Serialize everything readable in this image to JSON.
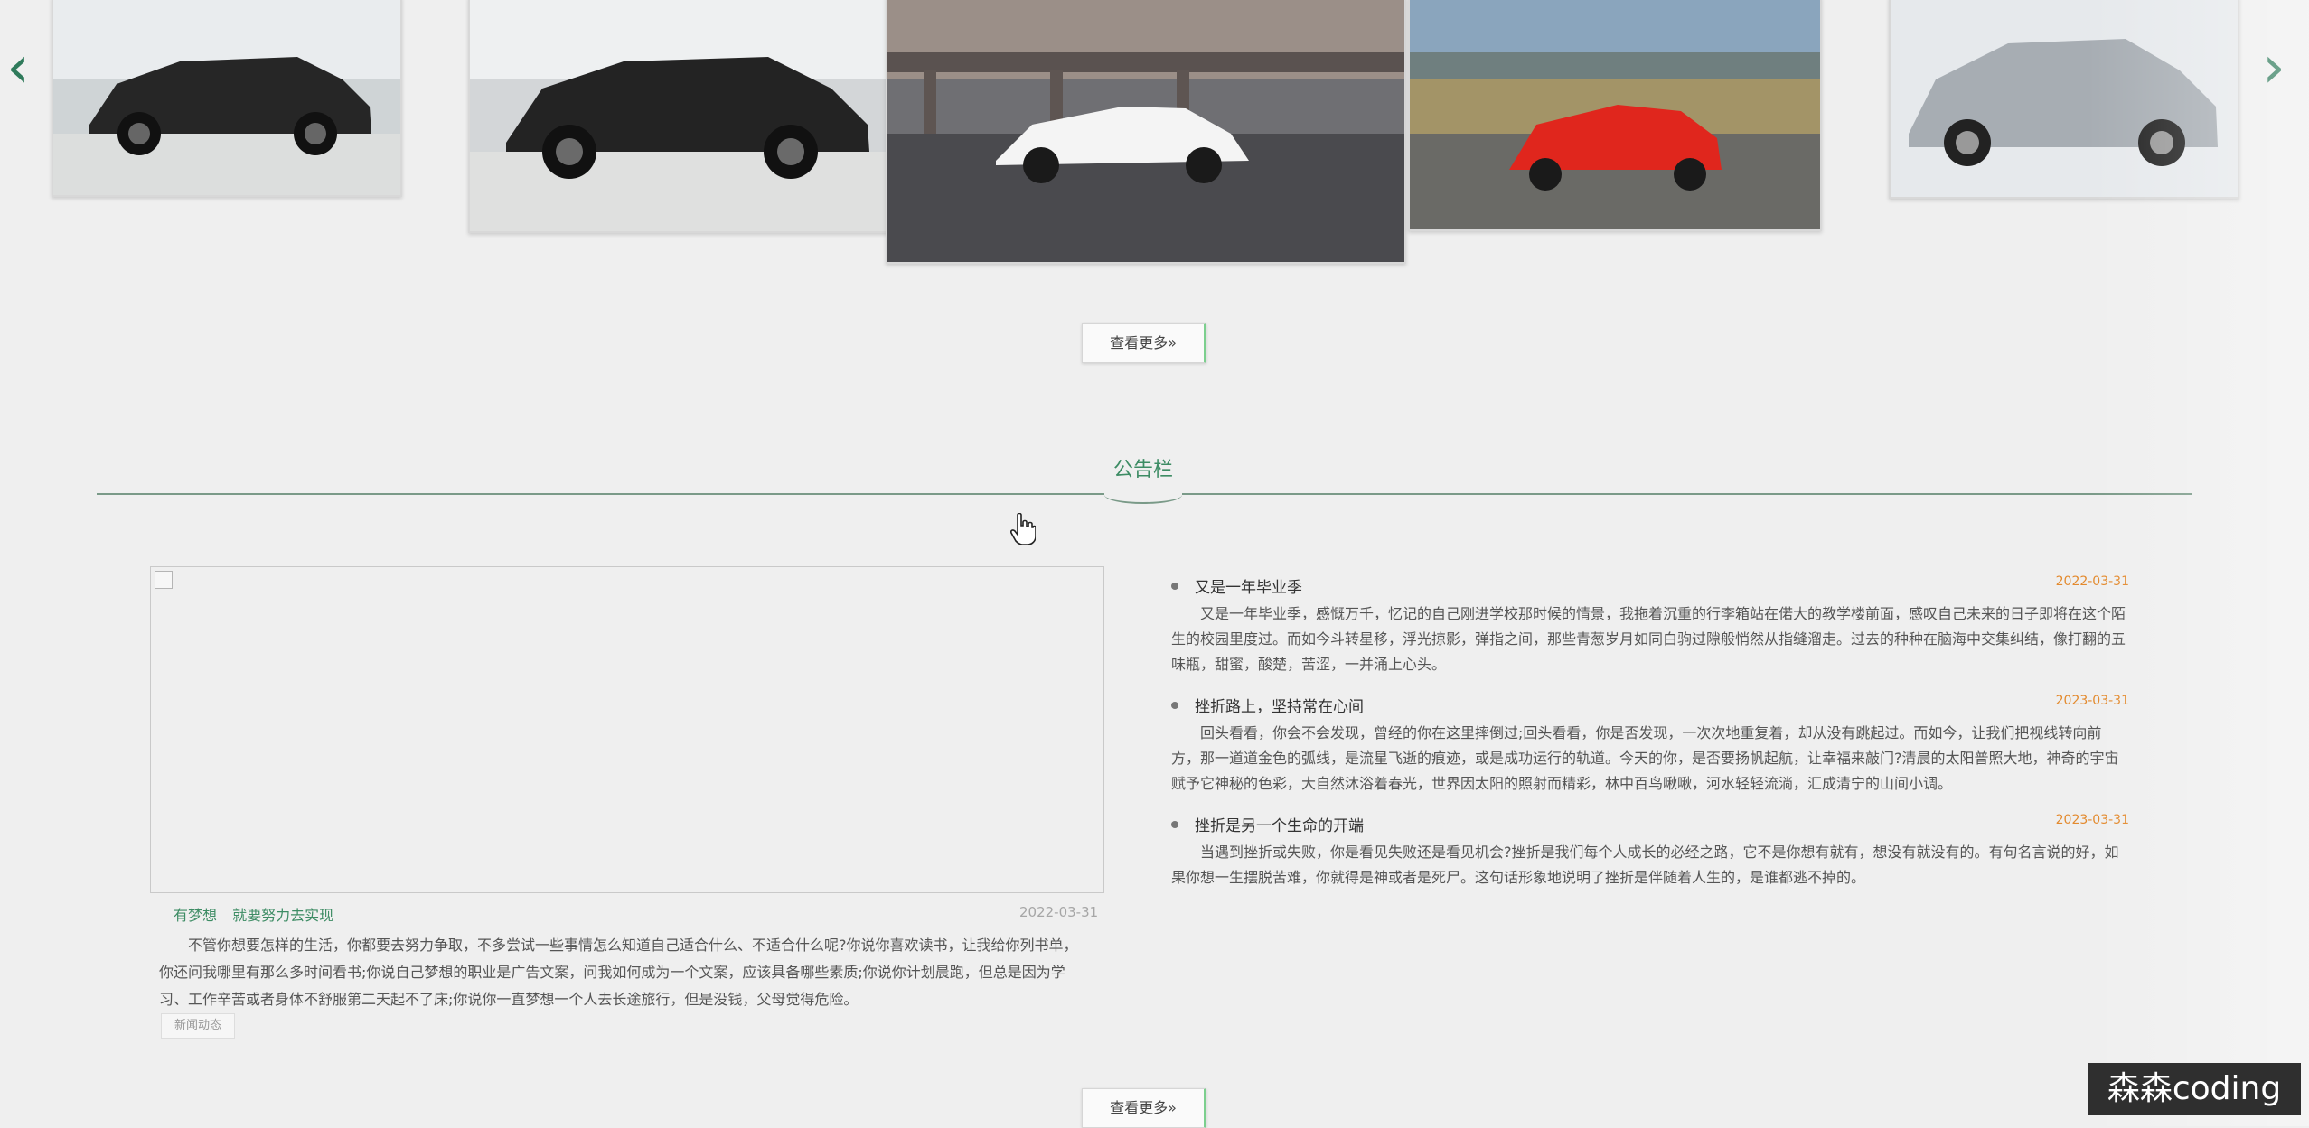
{
  "carousel": {
    "prev_label": "‹",
    "next_label": "›",
    "slides": [
      {
        "alt": "black SUV in showroom",
        "accent": "#1f1f1f"
      },
      {
        "alt": "black SUV in showroom",
        "accent": "#1f1f1f"
      },
      {
        "alt": "white sports car under bridge",
        "accent": "#f2f2f2"
      },
      {
        "alt": "red sports car on road",
        "accent": "#d8251c"
      },
      {
        "alt": "silver sedan",
        "accent": "#a9b0b6"
      }
    ]
  },
  "more_button_top": "查看更多»",
  "section": {
    "title": "公告栏"
  },
  "feature": {
    "tag_1": "有梦想",
    "tag_2": "就要努力去实现",
    "date": "2022-03-31",
    "text": "不管你想要怎样的生活，你都要去努力争取，不多尝试一些事情怎么知道自己适合什么、不适合什么呢?你说你喜欢读书，让我给你列书单，你还问我哪里有那么多时间看书;你说自己梦想的职业是广告文案，问我如何成为一个文案，应该具备哪些素质;你说你计划晨跑，但总是因为学习、工作辛苦或者身体不舒服第二天起不了床;你说你一直梦想一个人去长途旅行，但是没钱，父母觉得危险。",
    "badge": "新闻动态"
  },
  "news": [
    {
      "title": "又是一年毕业季",
      "date": "2022-03-31",
      "body": "又是一年毕业季，感慨万千，忆记的自己刚进学校那时候的情景，我拖着沉重的行李箱站在偌大的教学楼前面，感叹自己未来的日子即将在这个陌生的校园里度过。而如今斗转星移，浮光掠影，弹指之间，那些青葱岁月如同白驹过隙般悄然从指缝溜走。过去的种种在脑海中交集纠结，像打翻的五味瓶，甜蜜，酸楚，苦涩，一并涌上心头。"
    },
    {
      "title": "挫折路上，坚持常在心间",
      "date": "2023-03-31",
      "body": "回头看看，你会不会发现，曾经的你在这里摔倒过;回头看看，你是否发现，一次次地重复着，却从没有跳起过。而如今，让我们把视线转向前方，那一道道金色的弧线，是流星飞逝的痕迹，或是成功运行的轨道。今天的你，是否要扬帆起航，让幸福来敲门?清晨的太阳普照大地，神奇的宇宙赋予它神秘的色彩，大自然沐浴着春光，世界因太阳的照射而精彩，林中百鸟啾啾，河水轻轻流淌，汇成清宁的山间小调。"
    },
    {
      "title": "挫折是另一个生命的开端",
      "date": "2023-03-31",
      "body": "当遇到挫折或失败，你是看见失败还是看见机会?挫折是我们每个人成长的必经之路，它不是你想有就有，想没有就没有的。有句名言说的好，如果你想一生摆脱苦难，你就得是神或者是死尸。这句话形象地说明了挫折是伴随着人生的，是谁都逃不掉的。"
    }
  ],
  "more_button_bottom": "查看更多»",
  "watermark": "森森coding",
  "colors": {
    "accent_green": "#3d8c64",
    "date_orange": "#e38a2e",
    "background": "#efefef"
  }
}
